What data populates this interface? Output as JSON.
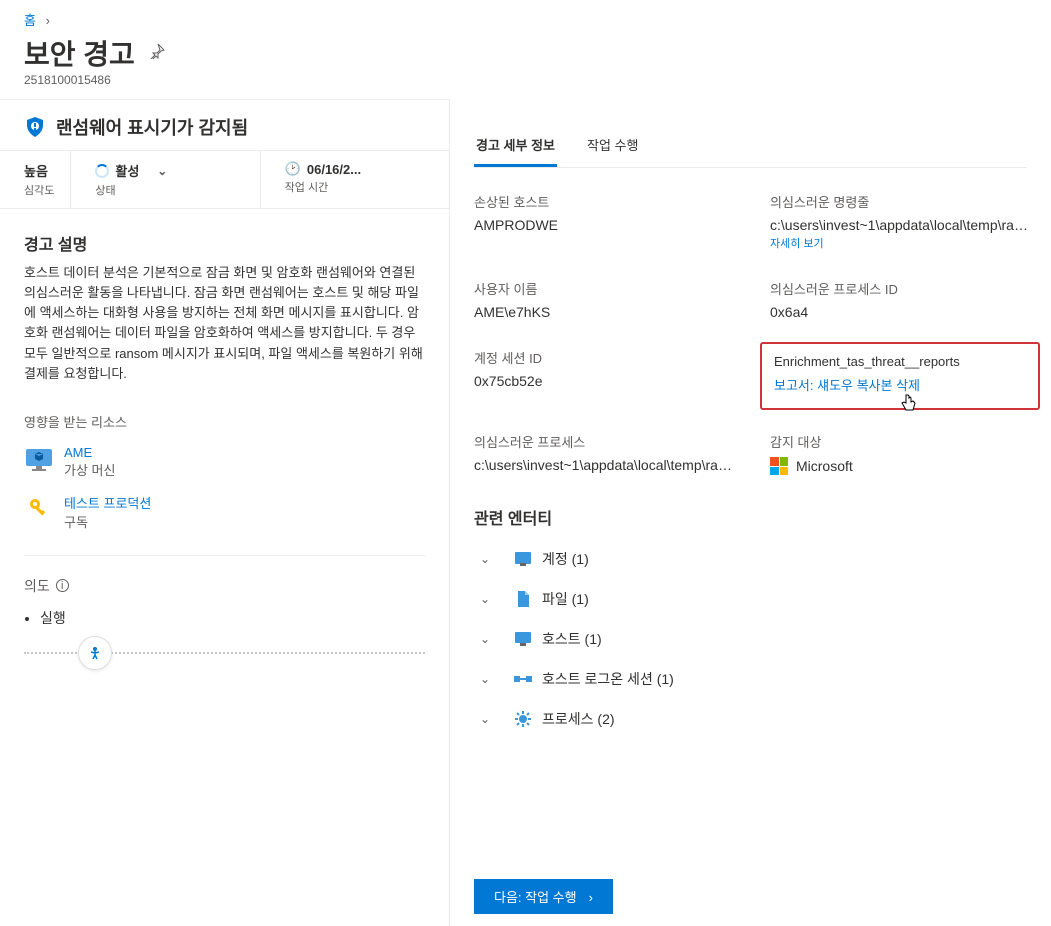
{
  "breadcrumb": {
    "home": "홈"
  },
  "title": "보안 경고",
  "alert_id": "2518100015486",
  "alert_name": "랜섬웨어 표시기가 감지됨",
  "status_row": {
    "severity_val": "높음",
    "severity_lbl": "심각도",
    "status_val": "활성",
    "status_lbl": "상태",
    "time_val": "06/16/2...",
    "time_lbl": "작업 시간"
  },
  "desc_title": "경고 설명",
  "desc_body": "호스트 데이터 분석은 기본적으로 잠금 화면 및 암호화 랜섬웨어와 연결된 의심스러운 활동을 나타냅니다. 잠금 화면 랜섬웨어는 호스트 및 해당 파일에 액세스하는 대화형 사용을 방지하는 전체 화면 메시지를 표시합니다. 암호화 랜섬웨어는 데이터 파일을 암호화하여 액세스를 방지합니다. 두 경우 모두 일반적으로 ransom 메시지가 표시되며, 파일 액세스를 복원하기 위해 결제를 요청합니다.",
  "affected_lbl": "영향을 받는 리소스",
  "resources": [
    {
      "name": "AME",
      "type": "가상 머신"
    },
    {
      "name": "테스트 프로덕션",
      "type": "구독"
    }
  ],
  "intent_lbl": "의도",
  "intent_items": [
    "실행"
  ],
  "tabs": {
    "details": "경고 세부 정보",
    "action": "작업 수행"
  },
  "details": {
    "host_lbl": "손상된 호스트",
    "host_val": "AMPRODWE",
    "cmd_lbl": "의심스러운 명령줄",
    "cmd_val": "c:\\users\\invest~1\\appdata\\local\\temp\\rans...",
    "cmd_more": "자세히 보기",
    "user_lbl": "사용자 이름",
    "user_val": "AME\\e7hKS",
    "pid_lbl": "의심스러운 프로세스 ID",
    "pid_val": "0x6a4",
    "sess_lbl": "계정 세션 ID",
    "sess_val": "0x75cb52e",
    "enrich_lbl": "Enrichment_tas_threat__reports",
    "enrich_link": "보고서: 섀도우 복사본 삭제",
    "proc_lbl": "의심스러운 프로세스",
    "proc_val": "c:\\users\\invest~1\\appdata\\local\\temp\\rans...",
    "detect_lbl": "감지 대상",
    "detect_val": "Microsoft"
  },
  "entities_title": "관련 엔터티",
  "entities": [
    {
      "label": "계정 (1)",
      "icon": "account"
    },
    {
      "label": "파일 (1)",
      "icon": "file"
    },
    {
      "label": "호스트 (1)",
      "icon": "host"
    },
    {
      "label": "호스트 로그온 세션 (1)",
      "icon": "session"
    },
    {
      "label": "프로세스 (2)",
      "icon": "process"
    }
  ],
  "next_btn": "다음: 작업 수행"
}
